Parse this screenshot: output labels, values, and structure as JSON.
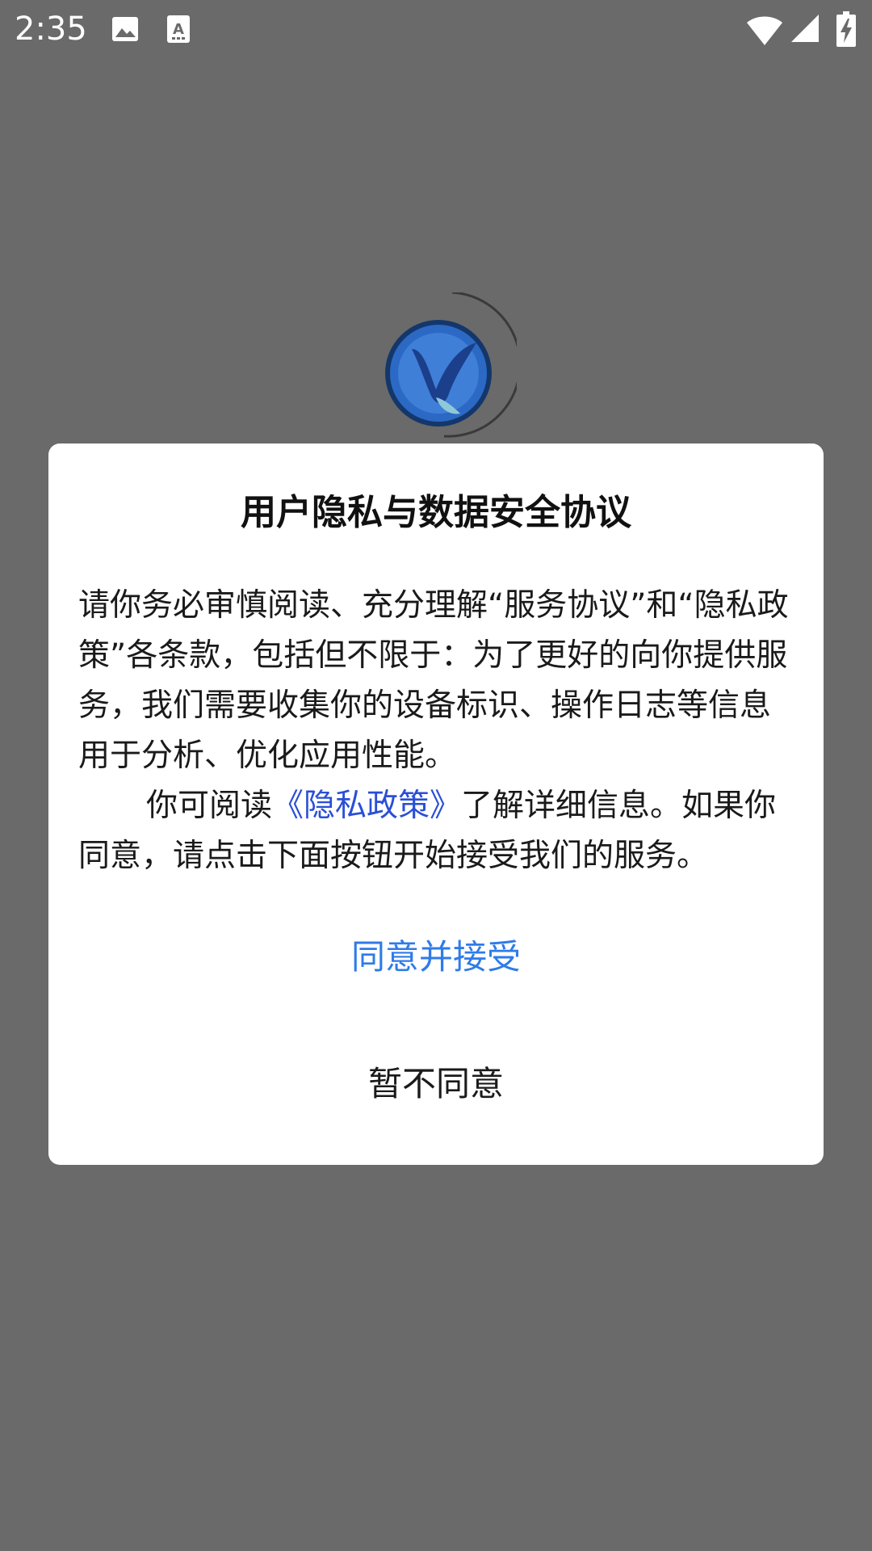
{
  "status_bar": {
    "time": "2:35",
    "icons": [
      "image-icon",
      "text-recognition-icon",
      "wifi-icon",
      "cell-signal-icon",
      "battery-charging-icon"
    ]
  },
  "colors": {
    "overlay_background": "#6a6a6a",
    "link_blue": "#2a4fd6",
    "accept_blue": "#2f7be8",
    "logo_blue": "#1f5fb8"
  },
  "dialog": {
    "title": "用户隐私与数据安全协议",
    "paragraph1": "请你务必审慎阅读、充分理解“服务协议”和“隐私政策”各条款，包括但不限于：为了更好的向你提供服务，我们需要收集你的设备标识、操作日志等信息用于分析、优化应用性能。",
    "paragraph2_prefix": "你可阅读",
    "policy_link": "《隐私政策》",
    "paragraph2_suffix": "了解详细信息。如果你同意，请点击下面按钮开始接受我们的服务。",
    "agree_label": "同意并接受",
    "decline_label": "暂不同意"
  }
}
